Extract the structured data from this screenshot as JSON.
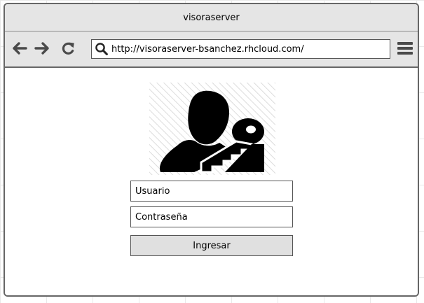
{
  "window": {
    "title": "visoraserver"
  },
  "toolbar": {
    "back_icon": "arrow-left-icon",
    "forward_icon": "arrow-right-icon",
    "reload_icon": "reload-icon",
    "search_icon": "search-icon",
    "menu_icon": "hamburger-menu-icon",
    "url": "http://visoraserver-bsanchez.rhcloud.com/"
  },
  "login": {
    "logo_icon": "user-key-icon",
    "username_placeholder": "Usuario",
    "password_placeholder": "Contraseña",
    "submit_label": "Ingresar"
  },
  "colors": {
    "chrome": "#e5e5e5",
    "border": "#666666",
    "button": "#e0e0e0"
  }
}
